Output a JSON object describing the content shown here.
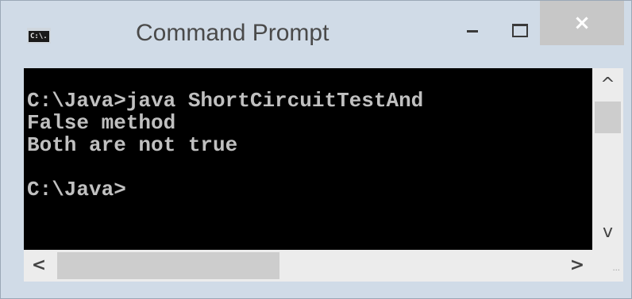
{
  "window": {
    "title": "Command Prompt",
    "icon_name": "cmd-icon",
    "icon_text": "C:\\.",
    "controls": {
      "minimize_icon": "minimize-icon",
      "maximize_icon": "maximize-icon",
      "close_label": "×",
      "close_color": "#c7c7c7"
    }
  },
  "console": {
    "background": "#000000",
    "text_color": "#c0c0c0",
    "lines": [
      "C:\\Java>java ShortCircuitTestAnd",
      "False method",
      "Both are not true",
      "",
      "C:\\Java>"
    ]
  },
  "scrollbars": {
    "up_arrow": "^",
    "down_arrow": "v",
    "left_arrow": "<",
    "right_arrow": ">",
    "grip": "···"
  }
}
